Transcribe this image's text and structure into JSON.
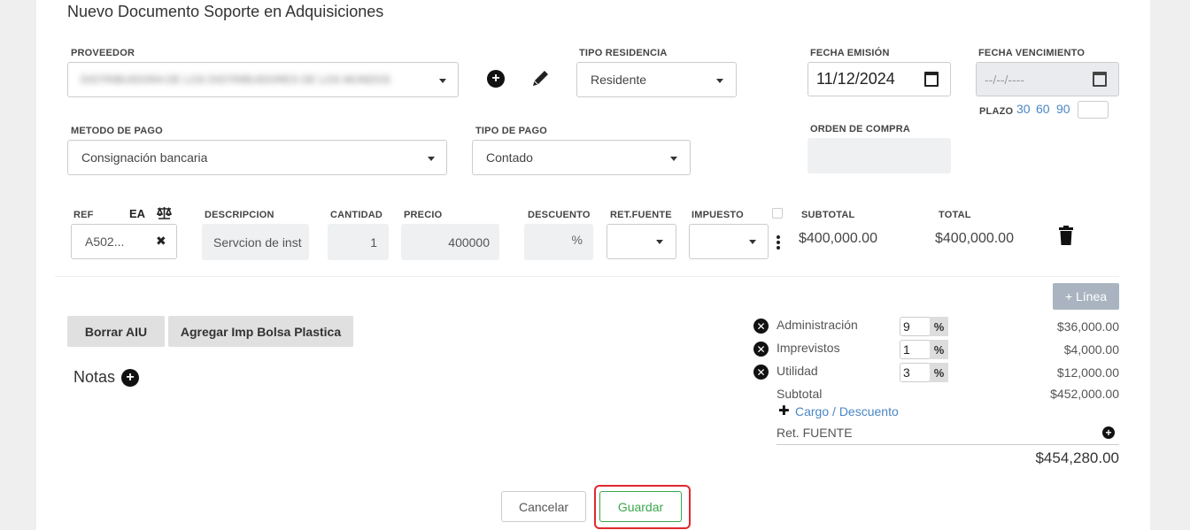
{
  "page": {
    "title": "Nuevo Documento Soporte en Adquisiciones"
  },
  "header": {
    "proveedor_label": "PROVEEDOR",
    "proveedor_value": "DISTRIBUIDORA DE LOS DISTRIBUIDORES DE LOS MUNDOS",
    "tipo_residencia_label": "TIPO RESIDENCIA",
    "tipo_residencia_value": "Residente",
    "fecha_emision_label": "FECHA EMISIÓN",
    "fecha_emision_value": "11/12/2024",
    "fecha_vencimiento_label": "FECHA VENCIMIENTO",
    "fecha_vencimiento_placeholder": "--/--/----",
    "plazo_label": "PLAZO",
    "plazo_options": [
      "30",
      "60",
      "90"
    ],
    "metodo_pago_label": "METODO DE PAGO",
    "metodo_pago_value": "Consignación bancaria",
    "tipo_pago_label": "TIPO DE PAGO",
    "tipo_pago_value": "Contado",
    "orden_compra_label": "ORDEN DE COMPRA"
  },
  "items": {
    "headers": {
      "ref": "REF",
      "ea": "EA",
      "descripcion": "DESCRIPCION",
      "cantidad": "CANTIDAD",
      "precio": "PRECIO",
      "descuento": "DESCUENTO",
      "retfuente": "RET.FUENTE",
      "impuesto": "IMPUESTO",
      "subtotal": "SUBTOTAL",
      "total": "TOTAL"
    },
    "row": {
      "ref": "A502...",
      "descripcion": "Servcion de inst",
      "cantidad": "1",
      "precio": "400000",
      "descuento_unit": "%",
      "subtotal": "$400,000.00",
      "total": "$400,000.00"
    },
    "add_line": "+ Línea"
  },
  "actions": {
    "borrar_aiu": "Borrar AIU",
    "agregar_bolsa": "Agregar Imp Bolsa Plastica",
    "notas": "Notas"
  },
  "summary": {
    "aiu": [
      {
        "label": "Administración",
        "pct": "9",
        "amount": "$36,000.00"
      },
      {
        "label": "Imprevistos",
        "pct": "1",
        "amount": "$4,000.00"
      },
      {
        "label": "Utilidad",
        "pct": "3",
        "amount": "$12,000.00"
      }
    ],
    "pct_symbol": "%",
    "subtotal_label": "Subtotal",
    "subtotal_value": "$452,000.00",
    "cargo": "Cargo",
    "separator": "/",
    "descuento": "Descuento",
    "ret_fuente_label": "Ret. FUENTE",
    "total_value": "$454,280.00"
  },
  "footer": {
    "cancel": "Cancelar",
    "save": "Guardar"
  },
  "colors": {
    "accent_link": "#4a86c5",
    "save_green": "#3aa64b",
    "highlight_red": "#e0282e"
  }
}
